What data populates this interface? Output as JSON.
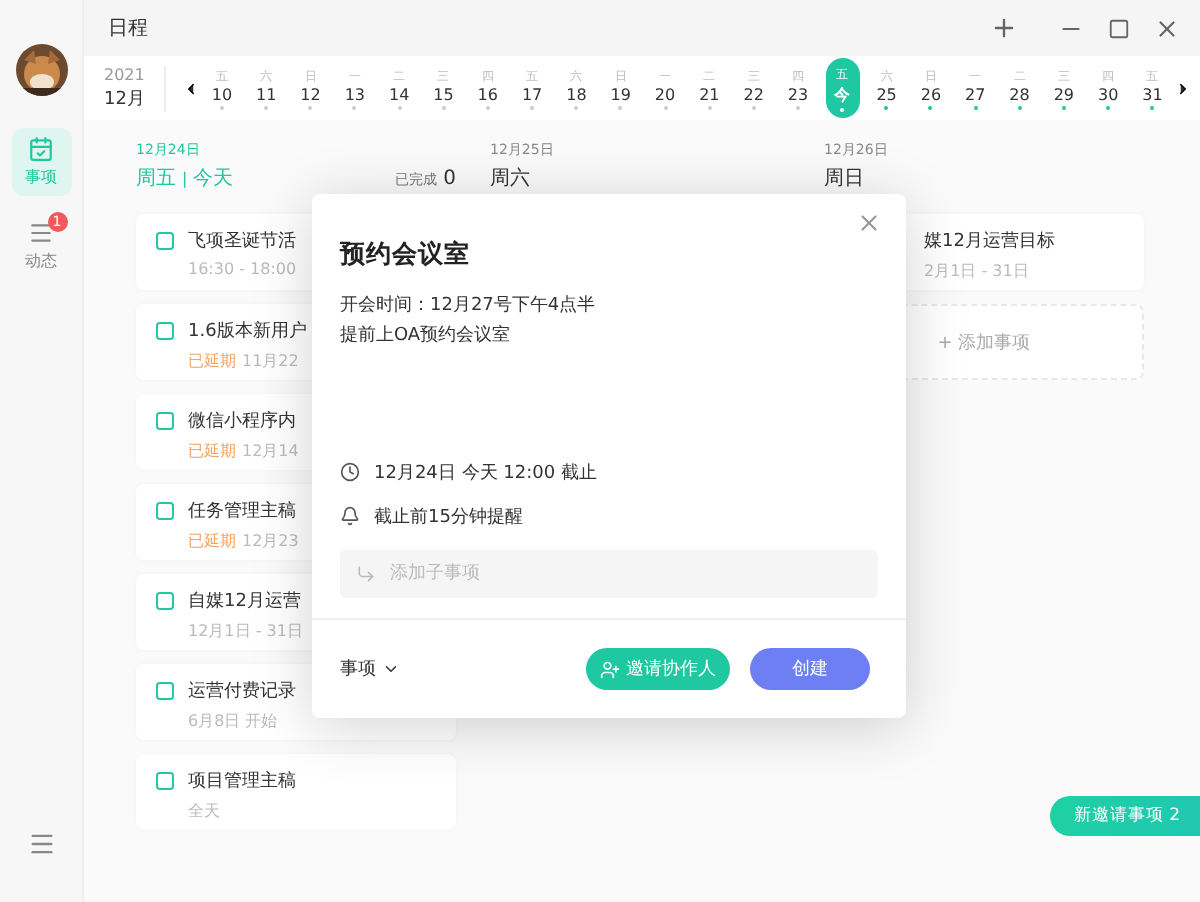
{
  "window": {
    "title": "日程"
  },
  "sidebar": {
    "items": [
      {
        "label": "事项",
        "kind": "tasks",
        "selected": true
      },
      {
        "label": "动态",
        "kind": "feed",
        "selected": false,
        "badge": "1"
      }
    ]
  },
  "date_strip": {
    "year": "2021",
    "month": "12月",
    "days": [
      {
        "weekday": "五",
        "date": "10",
        "selected": false,
        "color": "#cccccc"
      },
      {
        "weekday": "六",
        "date": "11",
        "selected": false,
        "color": "#cccccc"
      },
      {
        "weekday": "日",
        "date": "12",
        "selected": false,
        "color": "#cccccc"
      },
      {
        "weekday": "一",
        "date": "13",
        "selected": false,
        "color": "#cccccc"
      },
      {
        "weekday": "二",
        "date": "14",
        "selected": false,
        "color": "#cccccc"
      },
      {
        "weekday": "三",
        "date": "15",
        "selected": false,
        "color": "#cccccc"
      },
      {
        "weekday": "四",
        "date": "16",
        "selected": false,
        "color": "#cccccc"
      },
      {
        "weekday": "五",
        "date": "17",
        "selected": false,
        "color": "#cccccc"
      },
      {
        "weekday": "六",
        "date": "18",
        "selected": false,
        "color": "#cccccc"
      },
      {
        "weekday": "日",
        "date": "19",
        "selected": false,
        "color": "#cccccc"
      },
      {
        "weekday": "一",
        "date": "20",
        "selected": false,
        "color": "#cccccc"
      },
      {
        "weekday": "二",
        "date": "21",
        "selected": false,
        "color": "#cccccc"
      },
      {
        "weekday": "三",
        "date": "22",
        "selected": false,
        "color": "#cccccc"
      },
      {
        "weekday": "四",
        "date": "23",
        "selected": false,
        "color": "#cccccc"
      },
      {
        "weekday": "五",
        "date": "今",
        "selected": true,
        "color": "#ffffff"
      },
      {
        "weekday": "六",
        "date": "25",
        "selected": false,
        "color": "#1fc8a0"
      },
      {
        "weekday": "日",
        "date": "26",
        "selected": false,
        "color": "#1fc8a0"
      },
      {
        "weekday": "一",
        "date": "27",
        "selected": false,
        "color": "#1fc8a0"
      },
      {
        "weekday": "二",
        "date": "28",
        "selected": false,
        "color": "#1fc8a0"
      },
      {
        "weekday": "三",
        "date": "29",
        "selected": false,
        "color": "#1fc8a0"
      },
      {
        "weekday": "四",
        "date": "30",
        "selected": false,
        "color": "#1fc8a0"
      },
      {
        "weekday": "五",
        "date": "31",
        "selected": false,
        "color": "#1fc8a0"
      }
    ]
  },
  "columns": [
    {
      "date": "12月24日",
      "weekday": "周五",
      "separator": "|",
      "today": "今天",
      "done_label": "已完成",
      "done_count": "0",
      "tasks": [
        {
          "title": "飞项圣诞节活",
          "checked": false,
          "time": "16:30 - 18:00"
        },
        {
          "title": "1.6版本新用户",
          "checked": false,
          "tag": "已延期",
          "time": "11月22"
        },
        {
          "title": "微信小程序内",
          "checked": false,
          "tag": "已延期",
          "time": "12月14"
        },
        {
          "title": "任务管理主稿",
          "checked": false,
          "tag": "已延期",
          "time": "12月23"
        },
        {
          "title": "自媒12月运营",
          "checked": false,
          "time": "12月1日 - 31日"
        },
        {
          "title": "运营付费记录",
          "checked": false,
          "time": "6月8日 开始"
        },
        {
          "title": "项目管理主稿",
          "checked": false,
          "time": "全天"
        }
      ]
    },
    {
      "date": "12月25日",
      "weekday": "周六"
    },
    {
      "date": "12月26日",
      "weekday": "周日",
      "tasks": [
        {
          "title": "媒12月运营目标",
          "time": "2月1日 - 31日"
        }
      ],
      "add_label": "+ 添加事项"
    }
  ],
  "dialog": {
    "title": "预约会议室",
    "description": [
      "开会时间：12月27号下午4点半",
      "提前上OA预约会议室"
    ],
    "due": "12月24日 今天 12:00 截止",
    "reminder": "截止前15分钟提醒",
    "subtask": {
      "placeholder": "添加子事项"
    },
    "type_label": "事项",
    "invite_button": "邀请协作人",
    "create_button": "创建"
  },
  "toast": "新邀请事项 2"
}
